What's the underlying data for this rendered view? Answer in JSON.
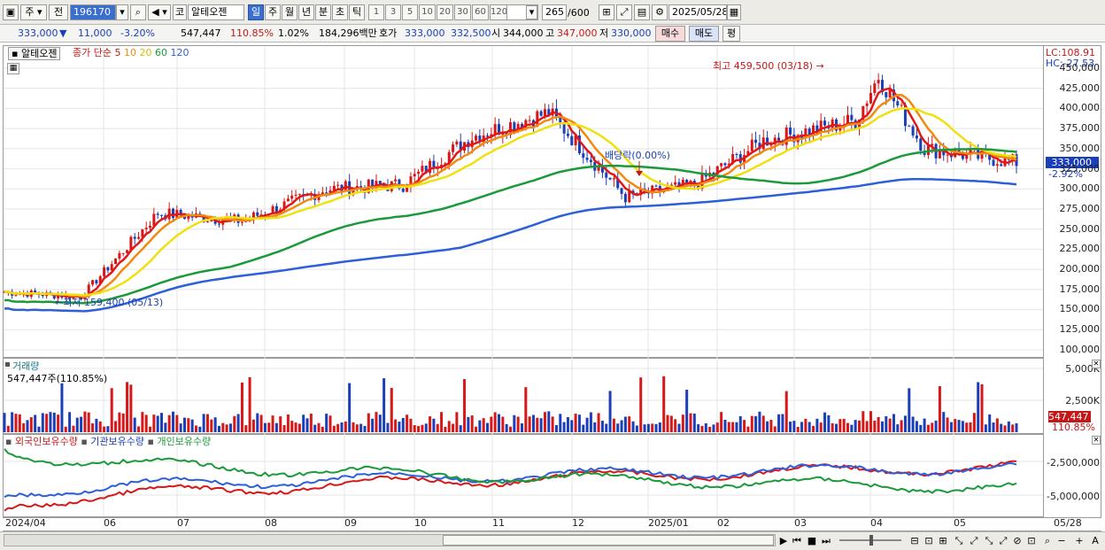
{
  "toolbar": {
    "market_label": "주",
    "prev_label": "전",
    "stock_code": "196170",
    "market_code": "코",
    "stock_name": "알테오젠",
    "period_buttons": [
      "일",
      "주",
      "월",
      "년",
      "분",
      "초",
      "틱"
    ],
    "active_period": "일",
    "interval_buttons": [
      "1",
      "3",
      "5",
      "10",
      "20",
      "30",
      "60",
      "120"
    ],
    "count_value": "265",
    "count_max": "/600",
    "date_value": "2025/05/28"
  },
  "quote": {
    "price": "333,000",
    "change_arrow": "▼",
    "change": "11,000",
    "change_pct": "-3.20%",
    "volume": "547,447",
    "volume_ratio": "110.85%",
    "turnover_pct": "1.02%",
    "amount": "184,296백만",
    "hoga_label": "호가",
    "ask": "333,000",
    "bid": "332,500",
    "open_label": "시",
    "open": "344,000",
    "high_label": "고",
    "high": "347,000",
    "low_label": "저",
    "low": "330,000",
    "buy_label": "매수",
    "sell_label": "매도",
    "avg_label": "평"
  },
  "main_chart": {
    "stock_tag": "알테오젠",
    "legend_prefix": "종가 단순",
    "ma_periods": [
      "5",
      "10",
      "20",
      "60",
      "120"
    ],
    "ma_colors": [
      "#e01818",
      "#f08a10",
      "#f0e010",
      "#1a9a3a",
      "#2c5fd8"
    ],
    "lc_text": "LC:108.91",
    "hc_text": "HC:-27.53",
    "price_tag": "333,000",
    "pct_tag": "-2.92%",
    "high_annotation": "최고 459,500 (03/18)",
    "low_annotation": "최저 159,400 (05/13)",
    "dividend_annotation": "배당락(0.00%)",
    "y_ticks": [
      "450,000",
      "425,000",
      "400,000",
      "375,000",
      "350,000",
      "325,000",
      "300,000",
      "275,000",
      "250,000",
      "225,000",
      "200,000",
      "175,000",
      "150,000",
      "125,000",
      "100,000"
    ]
  },
  "volume_chart": {
    "title": "거래량",
    "value_text": "547,447주(110.85%)",
    "y_ticks": [
      "5,000K",
      "2,500K"
    ],
    "value_tag": "547,447",
    "pct_tag": "110.85%"
  },
  "holding_chart": {
    "legend": [
      {
        "label": "외국인보유수량",
        "color": "#d81818"
      },
      {
        "label": "기관보유수량",
        "color": "#2c5fd8"
      },
      {
        "label": "개인보유수량",
        "color": "#1a9a3a"
      }
    ],
    "y_ticks": [
      "-2,500,000",
      "-5,000,000"
    ]
  },
  "x_axis": {
    "labels": [
      "2024/04",
      "06",
      "07",
      "08",
      "09",
      "10",
      "11",
      "12",
      "2025/01",
      "02",
      "03",
      "04",
      "05",
      "05/28"
    ]
  },
  "chart_data": {
    "type": "line",
    "title": "",
    "x_range": [
      "2024/04",
      "2025/05/28"
    ],
    "ylim": [
      100000,
      460000
    ],
    "series": [
      {
        "name": "5",
        "type": "line",
        "x": [
          "2024/04",
          "2024/05/13",
          "2024/06",
          "2024/07",
          "2024/08",
          "2024/09",
          "2024/10",
          "2024/11",
          "2024/12",
          "2025/01",
          "2025/02",
          "2025/03",
          "2025/03/18",
          "2025/04",
          "2025/05",
          "2025/05/28"
        ],
        "values": [
          172000,
          166000,
          270000,
          260000,
          300000,
          305000,
          365000,
          395000,
          290000,
          305000,
          360000,
          385000,
          440000,
          350000,
          340000,
          333000
        ]
      }
    ],
    "annotations": [
      {
        "text": "최고 459,500 (03/18)",
        "x": "2025/03/18",
        "y": 459500
      },
      {
        "text": "최저 159,400 (05/13)",
        "x": "2024/05/13",
        "y": 159400
      },
      {
        "text": "배당락(0.00%)",
        "x": "2024/12"
      }
    ]
  }
}
